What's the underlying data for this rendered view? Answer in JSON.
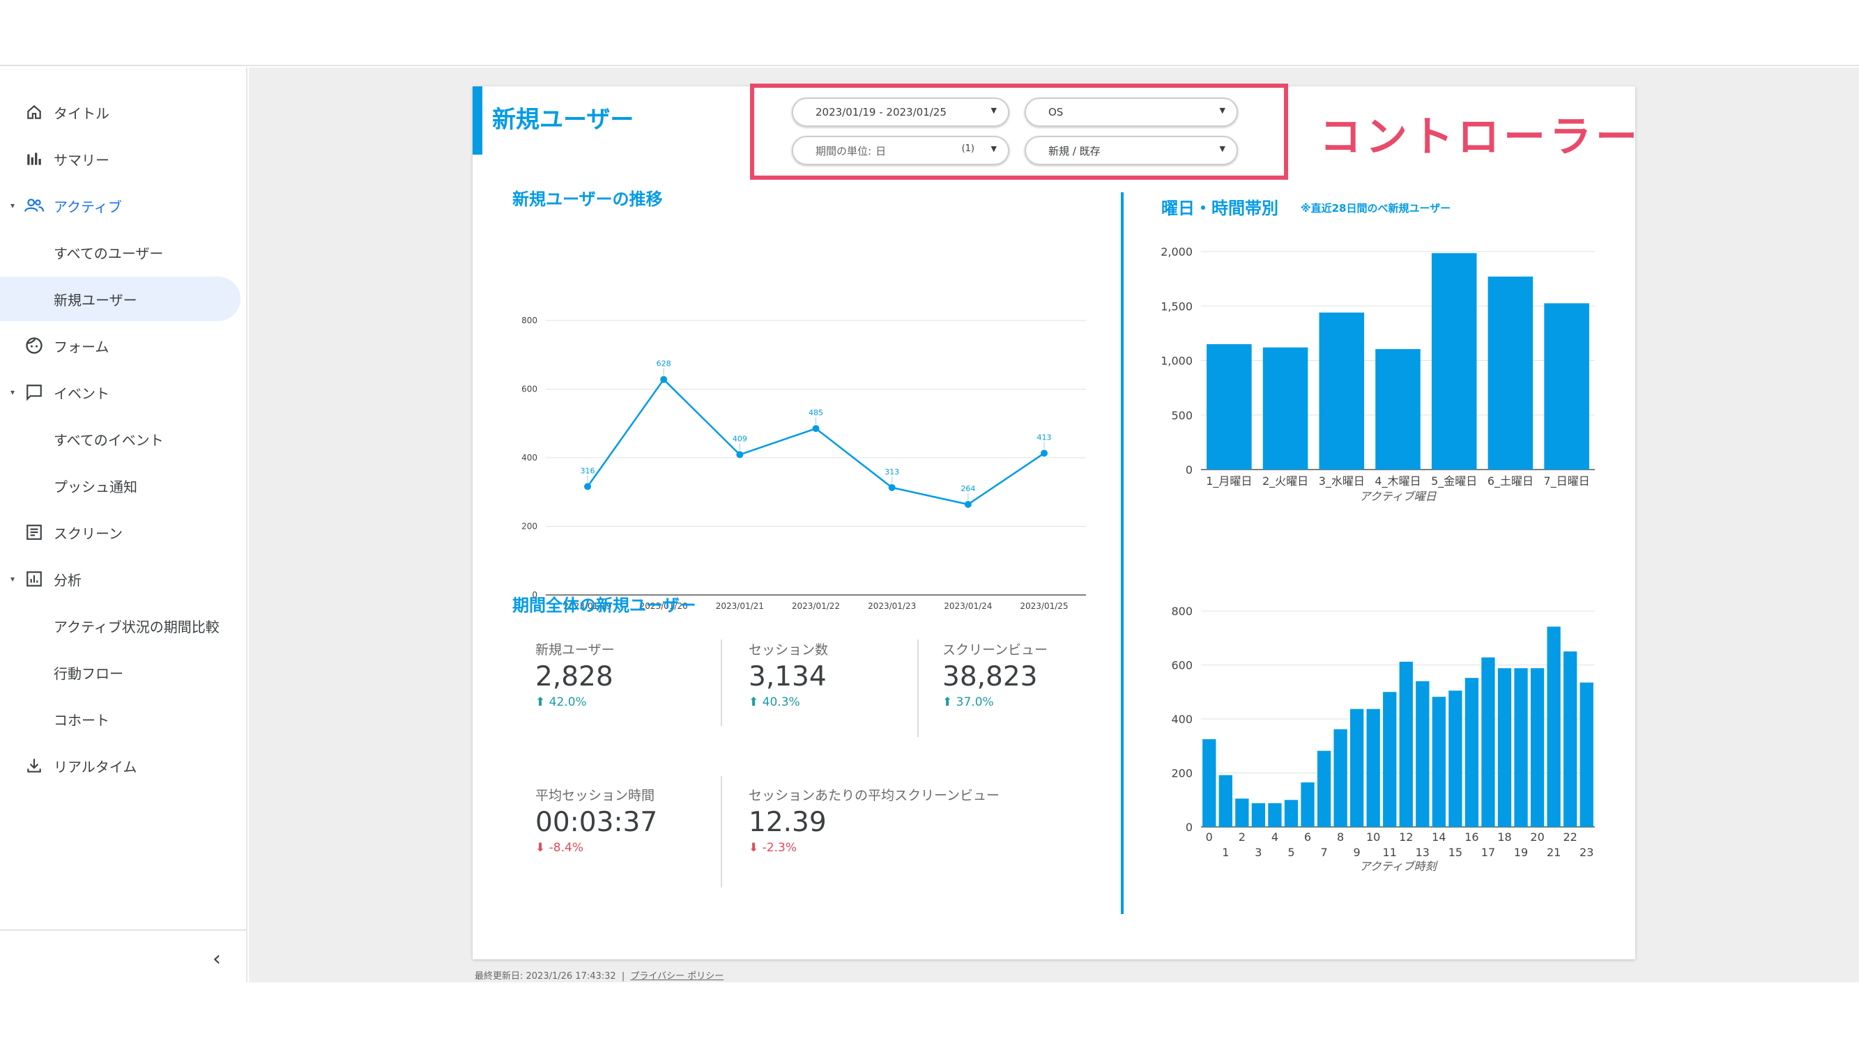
{
  "sidebar": {
    "items": [
      {
        "label": "タイトル"
      },
      {
        "label": "サマリー"
      },
      {
        "label": "アクティブ"
      },
      {
        "label": "すべてのユーザー"
      },
      {
        "label": "新規ユーザー"
      },
      {
        "label": "フォーム"
      },
      {
        "label": "イベント"
      },
      {
        "label": "すべてのイベント"
      },
      {
        "label": "プッシュ通知"
      },
      {
        "label": "スクリーン"
      },
      {
        "label": "分析"
      },
      {
        "label": "アクティブ状況の期間比較"
      },
      {
        "label": "行動フロー"
      },
      {
        "label": "コホート"
      },
      {
        "label": "リアルタイム"
      }
    ],
    "collapse_glyph": "‹"
  },
  "report": {
    "title": "新規ユーザー",
    "controls": {
      "date_range": "2023/01/19 - 2023/01/25",
      "os": "OS",
      "period_unit_label": "期間の単位:",
      "period_unit_value": "日",
      "period_unit_count": "(1)",
      "user_type": "新規 / 既存"
    },
    "controller_label": "コントローラー",
    "trend_title": "新規ユーザーの推移",
    "summary_title": "期間全体の新規ユーザー",
    "weekday_title": "曜日・時間帯別",
    "weekday_note": "※直近28日間のべ新規ユーザー",
    "kpis": [
      {
        "label": "新規ユーザー",
        "value": "2,828",
        "delta": "42.0%",
        "dir": "up"
      },
      {
        "label": "セッション数",
        "value": "3,134",
        "delta": "40.3%",
        "dir": "up"
      },
      {
        "label": "スクリーンビュー",
        "value": "38,823",
        "delta": "37.0%",
        "dir": "up"
      },
      {
        "label": "平均セッション時間",
        "value": "00:03:37",
        "delta": "-8.4%",
        "dir": "down"
      },
      {
        "label": "セッションあたりの平均スクリーンビュー",
        "value": "12.39",
        "delta": "-2.3%",
        "dir": "down"
      }
    ],
    "footer": {
      "updated": "最終更新日: 2023/1/26 17:43:32",
      "sep": "|",
      "privacy": "プライバシー ポリシー"
    }
  },
  "colors": {
    "accent": "#039be5",
    "highlight": "#ea4a6a",
    "up": "#1e9aa8",
    "down": "#e24a5c"
  },
  "chart_data": [
    {
      "type": "line",
      "x": [
        "2023/01/19",
        "2023/01/20",
        "2023/01/21",
        "2023/01/22",
        "2023/01/23",
        "2023/01/24",
        "2023/01/25"
      ],
      "values": [
        316,
        628,
        409,
        485,
        313,
        264,
        413
      ],
      "yticks": [
        0,
        200,
        400,
        600,
        800
      ],
      "ylim": [
        0,
        800
      ],
      "grid": true
    },
    {
      "type": "bar",
      "categories": [
        "1_月曜日",
        "2_火曜日",
        "3_水曜日",
        "4_木曜日",
        "5_金曜日",
        "6_土曜日",
        "7_日曜日"
      ],
      "values": [
        1150,
        1120,
        1440,
        1105,
        1985,
        1770,
        1525
      ],
      "yticks": [
        "0",
        "500",
        "1,000",
        "1,500",
        "2,000"
      ],
      "ylim": [
        0,
        2000
      ],
      "xlabel": "アクティブ曜日",
      "grid": true
    },
    {
      "type": "bar",
      "categories": [
        "0",
        "1",
        "2",
        "3",
        "4",
        "5",
        "6",
        "7",
        "8",
        "9",
        "10",
        "11",
        "12",
        "13",
        "14",
        "15",
        "16",
        "17",
        "18",
        "19",
        "20",
        "21",
        "22",
        "23"
      ],
      "values": [
        325,
        192,
        105,
        88,
        88,
        100,
        165,
        282,
        362,
        437,
        437,
        500,
        612,
        540,
        482,
        505,
        552,
        628,
        588,
        588,
        588,
        742,
        650,
        535
      ],
      "yticks": [
        0,
        200,
        400,
        600,
        800
      ],
      "ylim": [
        0,
        800
      ],
      "xlabel": "アクティブ時刻",
      "grid": true
    }
  ]
}
